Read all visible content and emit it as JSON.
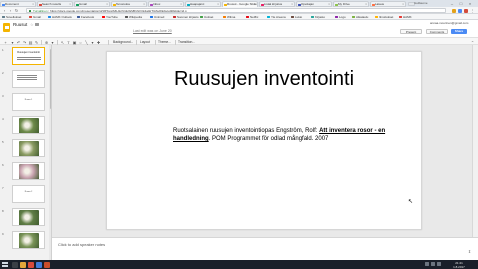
{
  "browser": {
    "user_chip": "Guillaume",
    "tabs": [
      {
        "label": "Document"
      },
      {
        "label": "Search results"
      },
      {
        "label": "Gmail"
      },
      {
        "label": "Tervetuloa"
      },
      {
        "label": "Inbox"
      },
      {
        "label": "Haapajarvi"
      },
      {
        "label": "Ruusut - Google Slides"
      },
      {
        "label": "Lisää kirjoitus"
      },
      {
        "label": "Opettajan"
      },
      {
        "label": "My Drive"
      },
      {
        "label": "Lataus"
      }
    ],
    "url_secure": "Turvallinen",
    "url": "https://docs.google.com/presentation/d/1RTop2A6H1cNrpkIGMlFzkQzk4a3qTIAfwOlk2s/edit#slide=id.p",
    "bookmarks": [
      {
        "label": "Sovellukset"
      },
      {
        "label": "Gmail"
      },
      {
        "label": "HAMK Outlook"
      },
      {
        "label": "Facebook"
      },
      {
        "label": "YouTube"
      },
      {
        "label": "Wikipedia"
      },
      {
        "label": "Unimed"
      },
      {
        "label": "Suomen kirjasto"
      },
      {
        "label": "Uutiset"
      },
      {
        "label": "Wilma"
      },
      {
        "label": "Netflix"
      },
      {
        "label": "Yle Areena"
      },
      {
        "label": "Lukio"
      },
      {
        "label": "Kirjasto"
      },
      {
        "label": "Logo"
      },
      {
        "label": "Aikataulu"
      },
      {
        "label": "Ilmoitukset"
      },
      {
        "label": "HAMK"
      }
    ]
  },
  "docs": {
    "title": "Ruusut",
    "menu": [
      "File",
      "Edit",
      "View",
      "Insert",
      "Slide",
      "Format",
      "Arrange",
      "Tools",
      "Table",
      "Help"
    ],
    "last_edit": "Last edit was on June 20",
    "user_email": "annaa.mourinen@gmail.com",
    "present_label": "Present",
    "comments_label": "Comments",
    "share_label": "Share",
    "toolbar": {
      "background_label": "Background...",
      "layout_label": "Layout",
      "theme_label": "Theme...",
      "transition_label": "Transition..."
    }
  },
  "filmstrip": {
    "slides": [
      {
        "num": "1",
        "type": "title",
        "text": "Ruusujen inventointi"
      },
      {
        "num": "2",
        "type": "text",
        "text": ""
      },
      {
        "num": "3",
        "type": "text",
        "text": "Ruusu 1"
      },
      {
        "num": "4",
        "type": "photo"
      },
      {
        "num": "5",
        "type": "photo"
      },
      {
        "num": "6",
        "type": "photo"
      },
      {
        "num": "7",
        "type": "text",
        "text": "Ruusu 2"
      },
      {
        "num": "8",
        "type": "photo"
      },
      {
        "num": "9",
        "type": "photo"
      }
    ]
  },
  "slide": {
    "title": "Ruusujen inventointi",
    "body_prefix": "Ruotsalainen ruusujen inventointiopas Engström, Rolf: ",
    "body_emph": "Att inventera rosor - en handledning",
    "body_suffix": ". POM Programmet för odlad mångfald. 2007"
  },
  "notes": {
    "placeholder": "Click to add speaker notes"
  },
  "taskbar": {
    "time": "21:41",
    "date": "1.8.2017"
  },
  "colors": {
    "share": "#4a8af4",
    "slides_brand": "#f4b400",
    "taskbar": "#1a1f2a"
  }
}
